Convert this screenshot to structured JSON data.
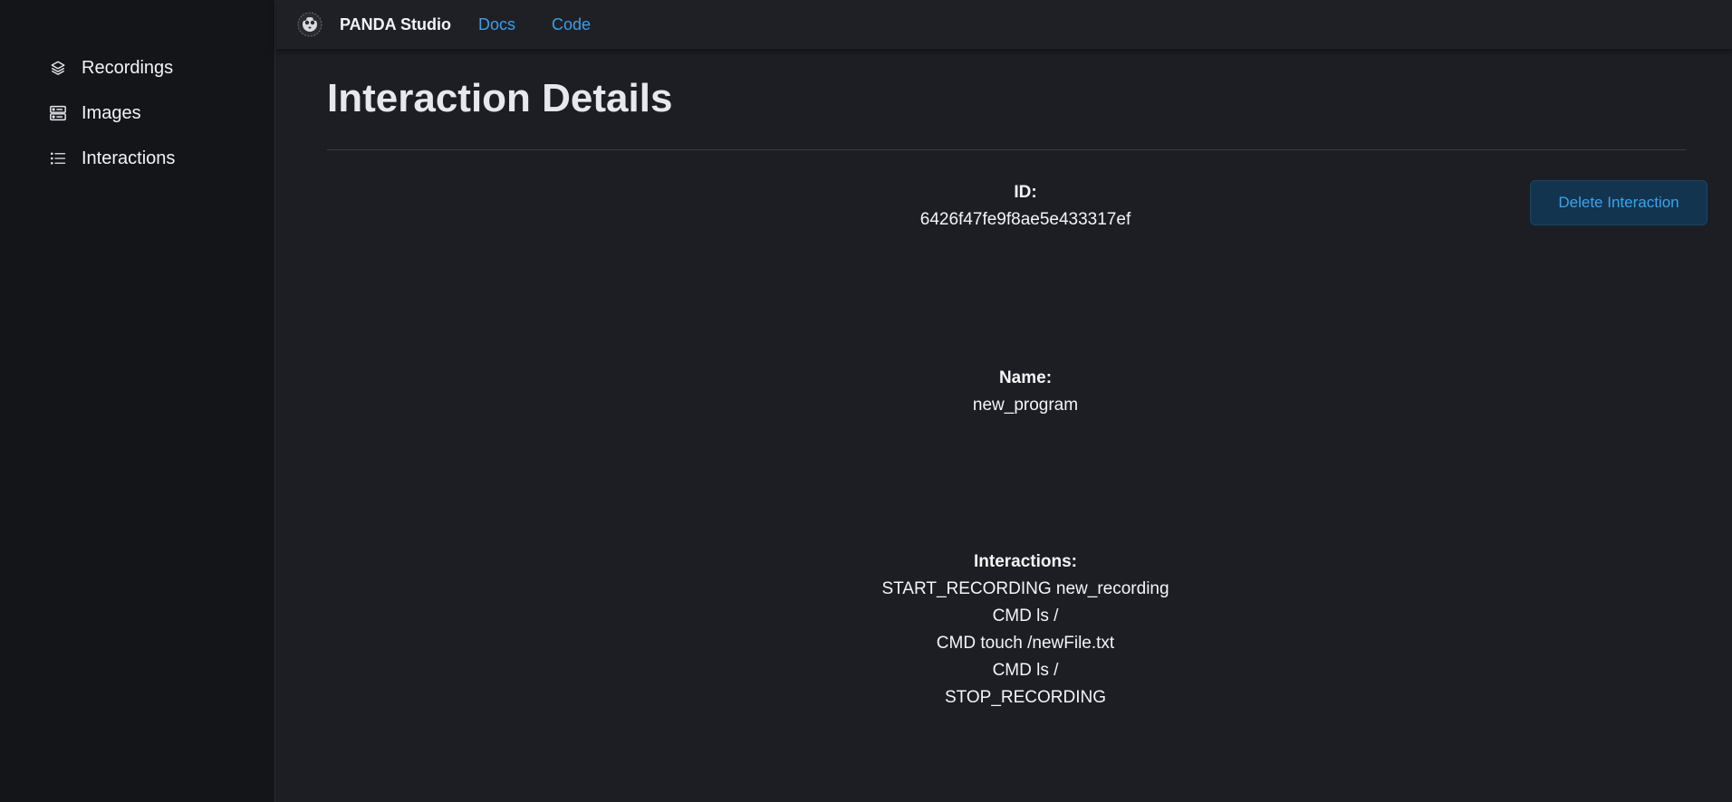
{
  "sidebar": {
    "items": [
      {
        "label": "Recordings",
        "icon": "layers-icon"
      },
      {
        "label": "Images",
        "icon": "server-icon"
      },
      {
        "label": "Interactions",
        "icon": "list-icon"
      }
    ]
  },
  "header": {
    "brand": "PANDA Studio",
    "links": [
      "Docs",
      "Code"
    ],
    "link_color": "#3d9ee8"
  },
  "main": {
    "title": "Interaction Details",
    "delete_label": "Delete Interaction",
    "id_label": "ID:",
    "id_value": "6426f47fe9f8ae5e433317ef",
    "name_label": "Name:",
    "name_value": "new_program",
    "interactions_label": "Interactions:",
    "interactions": [
      "START_RECORDING new_recording",
      "CMD ls /",
      "CMD touch /newFile.txt",
      "CMD ls /",
      "STOP_RECORDING"
    ]
  }
}
